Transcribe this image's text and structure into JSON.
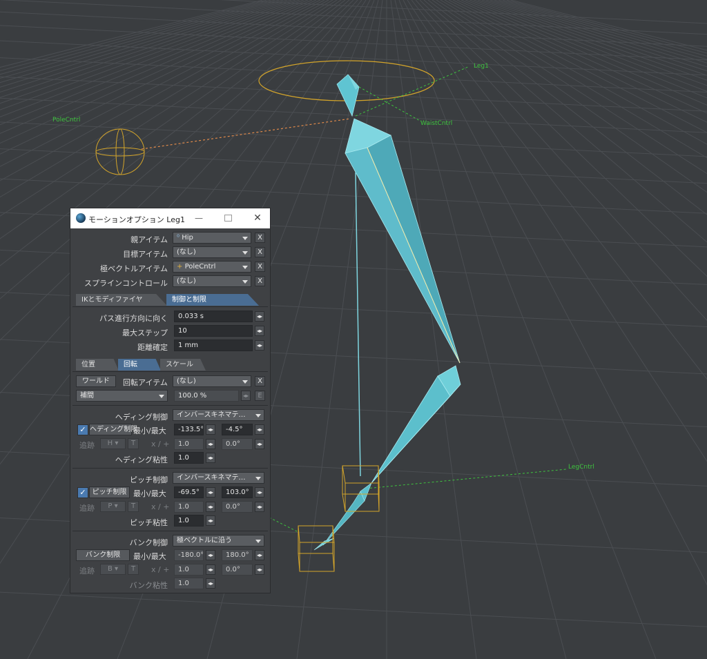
{
  "viewport": {
    "labels": {
      "pole_cntrl": "PoleCntrl",
      "leg1": "Leg1",
      "waist_cntrl": "WaistCntrl",
      "leg_cntrl": "LegCntrl"
    },
    "colors": {
      "background": "#3a3d40",
      "grid": "#4b4e52",
      "bone": "#62c9d6",
      "controller": "#d4a52a",
      "label": "#3ec43e",
      "pole_line": "#e08a4a"
    }
  },
  "window": {
    "title": "モーションオプション Leg1",
    "minimize": "—",
    "close": "✕"
  },
  "items": {
    "parent_label": "親アイテム",
    "parent_value": "Hip",
    "goal_label": "目標アイテム",
    "goal_value": "(なし)",
    "pole_label": "極ベクトルアイテム",
    "pole_value": "PoleCntrl",
    "spline_label": "スプラインコントロール",
    "spline_value": "(なし)",
    "clear": "X"
  },
  "main_tabs": [
    "IKとモディファイヤ",
    "制御と制限"
  ],
  "path": {
    "align_label": "パス進行方向に向く",
    "align_value": "0.033 s",
    "max_steps_label": "最大ステップ",
    "max_steps_value": "10",
    "distance_label": "距離確定",
    "distance_value": "1 mm"
  },
  "sub_tabs": [
    "位置",
    "回転",
    "スケール"
  ],
  "rotation": {
    "world_button": "ワールド",
    "rot_item_label": "回転アイテム",
    "rot_item_value": "(なし)",
    "interp_value": "補間",
    "percent_value": "100.0 %",
    "e_button": "E"
  },
  "heading": {
    "control_label": "ヘディング制御",
    "control_value": "インバースキネマテ…",
    "limit_button": "ヘディング制限",
    "minmax_label": "最小/最大",
    "min_value": "-133.5°",
    "max_value": "-4.5°",
    "follow_label": "追跡",
    "follow_axis": "H",
    "t_button": "T",
    "xplus_label": "x / +",
    "mult_value": "1.0",
    "offset_value": "0.0°",
    "stiff_label": "ヘディング粘性",
    "stiff_value": "1.0"
  },
  "pitch": {
    "control_label": "ピッチ制御",
    "control_value": "インバースキネマテ…",
    "limit_button": "ピッチ制限",
    "minmax_label": "最小/最大",
    "min_value": "-69.5°",
    "max_value": "103.0°",
    "follow_label": "追跡",
    "follow_axis": "P",
    "t_button": "T",
    "xplus_label": "x / +",
    "mult_value": "1.0",
    "offset_value": "0.0°",
    "stiff_label": "ピッチ粘性",
    "stiff_value": "1.0"
  },
  "bank": {
    "control_label": "バンク制御",
    "control_value": "極ベクトルに沿う",
    "limit_button": "バンク制限",
    "minmax_label": "最小/最大",
    "min_value": "-180.0°",
    "max_value": "180.0°",
    "follow_label": "追跡",
    "follow_axis": "B",
    "t_button": "T",
    "xplus_label": "x / +",
    "mult_value": "1.0",
    "offset_value": "0.0°",
    "stiff_label": "バンク粘性",
    "stiff_value": "1.0"
  },
  "check_glyph": "✓",
  "spin_glyph": "◂▸"
}
